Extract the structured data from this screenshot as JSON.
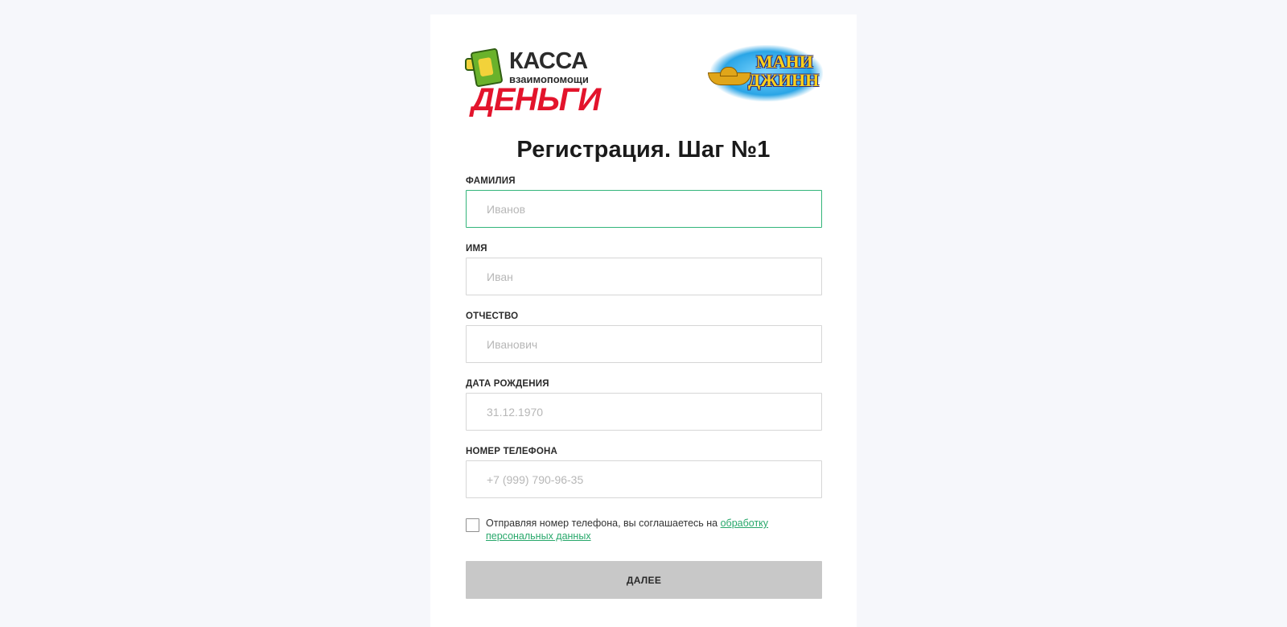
{
  "logos": {
    "kassa": {
      "line1": "КАССА",
      "line2": "взаимопомощи",
      "line3": "ДЕНЬГИ"
    },
    "money_jinn": {
      "line1": "МАНИ",
      "line2": "ДЖИНН"
    }
  },
  "page_title": "Регистрация. Шаг №1",
  "fields": {
    "last_name": {
      "label": "ФАМИЛИЯ",
      "placeholder": "Иванов",
      "value": ""
    },
    "first_name": {
      "label": "ИМЯ",
      "placeholder": "Иван",
      "value": ""
    },
    "middle_name": {
      "label": "ОТЧЕСТВО",
      "placeholder": "Иванович",
      "value": ""
    },
    "birth_date": {
      "label": "ДАТА РОЖДЕНИЯ",
      "placeholder": "31.12.1970",
      "value": ""
    },
    "phone": {
      "label": "НОМЕР ТЕЛЕФОНА",
      "placeholder": "+7 (999) 790-96-35",
      "value": ""
    }
  },
  "consent": {
    "text": "Отправляя номер телефона, вы соглашаетесь на ",
    "link": "обработку персональных данных",
    "checked": false
  },
  "next_button": "ДАЛЕЕ",
  "colors": {
    "accent": "#33b57a",
    "link": "#28a86b",
    "button_disabled": "#c8c8c8",
    "brand_red": "#e3142c"
  }
}
